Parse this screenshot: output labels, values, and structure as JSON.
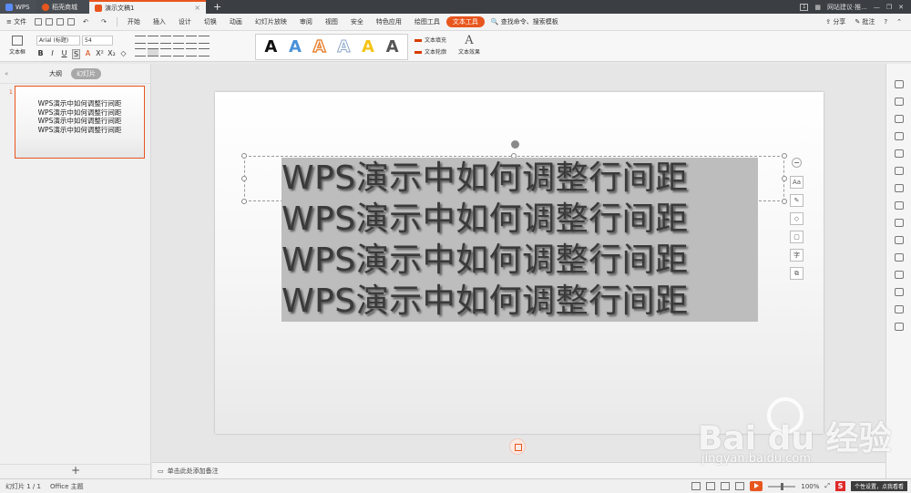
{
  "titlebar": {
    "tabs": [
      {
        "label": "WPS"
      },
      {
        "label": "稻壳商城"
      },
      {
        "label": "演示文稿1"
      }
    ],
    "new_tab": "+",
    "page_indicator": "1",
    "feedback": "网站建议·推..."
  },
  "menu": {
    "file": "文件",
    "items": [
      "开始",
      "插入",
      "设计",
      "切换",
      "动画",
      "幻灯片放映",
      "审阅",
      "视图",
      "安全",
      "特色应用",
      "绘图工具"
    ],
    "active": "文本工具",
    "search": "查找命令、搜索模板",
    "share": "分享",
    "comment": "批注",
    "help": "?"
  },
  "ribbon": {
    "textbox": "文本框",
    "font": "Arial (标题)",
    "size": "54",
    "fmt": [
      "B",
      "I",
      "U",
      "S",
      "A",
      "X²",
      "X₂",
      "◇"
    ],
    "styles": [
      {
        "label": "A",
        "color": "#111111"
      },
      {
        "label": "A",
        "color": "#4a90d9"
      },
      {
        "label": "A",
        "color": "#e8873a"
      },
      {
        "label": "A",
        "color": "#8aa6c8"
      },
      {
        "label": "A",
        "color": "#f5c518"
      },
      {
        "label": "A",
        "color": "#555555"
      }
    ],
    "text_fill": "文本填充",
    "text_outline": "文本轮廓",
    "text_effect": "文本效果"
  },
  "left_panel": {
    "outline_tab": "大纲",
    "slides_tab": "幻灯片",
    "thumb_number": "1",
    "thumb_lines": [
      "WPS演示中如何调整行间距",
      "WPS演示中如何调整行间距",
      "WPS演示中如何调整行间距",
      "WPS演示中如何调整行间距"
    ],
    "add": "+"
  },
  "slide": {
    "lines": [
      "WPS演示中如何调整行间距",
      "WPS演示中如何调整行间距",
      "WPS演示中如何调整行间距",
      "WPS演示中如何调整行间距"
    ]
  },
  "side_tools": [
    "−",
    "Aa",
    "✎",
    "◇",
    "▢",
    "字",
    "⧉"
  ],
  "notes": "单击此处添加备注",
  "status": {
    "slide_info": "幻灯片 1 / 1",
    "theme": "Office 主题",
    "zoom": "100%",
    "tooltip": "个性设置，点我看看",
    "s5": "S"
  },
  "watermark": {
    "brand": "Bai du 经验",
    "url": "jingyan.baidu.com"
  }
}
